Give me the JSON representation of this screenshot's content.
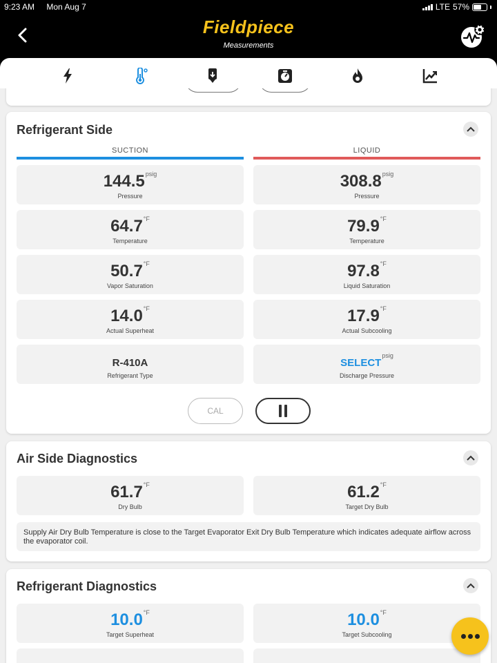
{
  "status": {
    "time": "9:23 AM",
    "date": "Mon Aug 7",
    "network": "LTE",
    "battery": "57%"
  },
  "header": {
    "logo": "Fieldpiece",
    "subtitle": "Measurements"
  },
  "tabs": [
    "electrical-icon",
    "temperature-icon",
    "charge-icon",
    "gauge-icon",
    "flame-icon",
    "chart-icon"
  ],
  "active_tab": 1,
  "colors": {
    "accent": "#f6c21c",
    "suction": "#1d8fe0",
    "liquid": "#e05a5a",
    "active_tab": "#1d8fe0"
  },
  "refrigerant_side": {
    "title": "Refrigerant Side",
    "suction_label": "SUCTION",
    "liquid_label": "LIQUID",
    "suction": [
      {
        "value": "144.5",
        "unit": "psig",
        "label": "Pressure"
      },
      {
        "value": "64.7",
        "unit": "°F",
        "label": "Temperature"
      },
      {
        "value": "50.7",
        "unit": "°F",
        "label": "Vapor Saturation"
      },
      {
        "value": "14.0",
        "unit": "°F",
        "label": "Actual Superheat"
      },
      {
        "value": "R-410A",
        "unit": "",
        "label": "Refrigerant Type"
      }
    ],
    "liquid": [
      {
        "value": "308.8",
        "unit": "psig",
        "label": "Pressure"
      },
      {
        "value": "79.9",
        "unit": "°F",
        "label": "Temperature"
      },
      {
        "value": "97.8",
        "unit": "°F",
        "label": "Liquid Saturation"
      },
      {
        "value": "17.9",
        "unit": "°F",
        "label": "Actual Subcooling"
      },
      {
        "value": "SELECT",
        "unit": "psig",
        "label": "Discharge Pressure"
      }
    ],
    "cal_label": "CAL"
  },
  "air_side": {
    "title": "Air Side Diagnostics",
    "tiles": [
      {
        "value": "61.7",
        "unit": "°F",
        "label": "Dry Bulb"
      },
      {
        "value": "61.2",
        "unit": "°F",
        "label": "Target Dry Bulb"
      }
    ],
    "message": "Supply Air Dry Bulb Temperature is close to the Target Evaporator Exit Dry Bulb Temperature which indicates adequate airflow across the evaporator coil."
  },
  "refrigerant_diagnostics": {
    "title": "Refrigerant Diagnostics",
    "tiles": [
      {
        "value": "10.0",
        "unit": "°F",
        "label": "Target Superheat"
      },
      {
        "value": "10.0",
        "unit": "°F",
        "label": "Target Subcooling"
      }
    ]
  }
}
